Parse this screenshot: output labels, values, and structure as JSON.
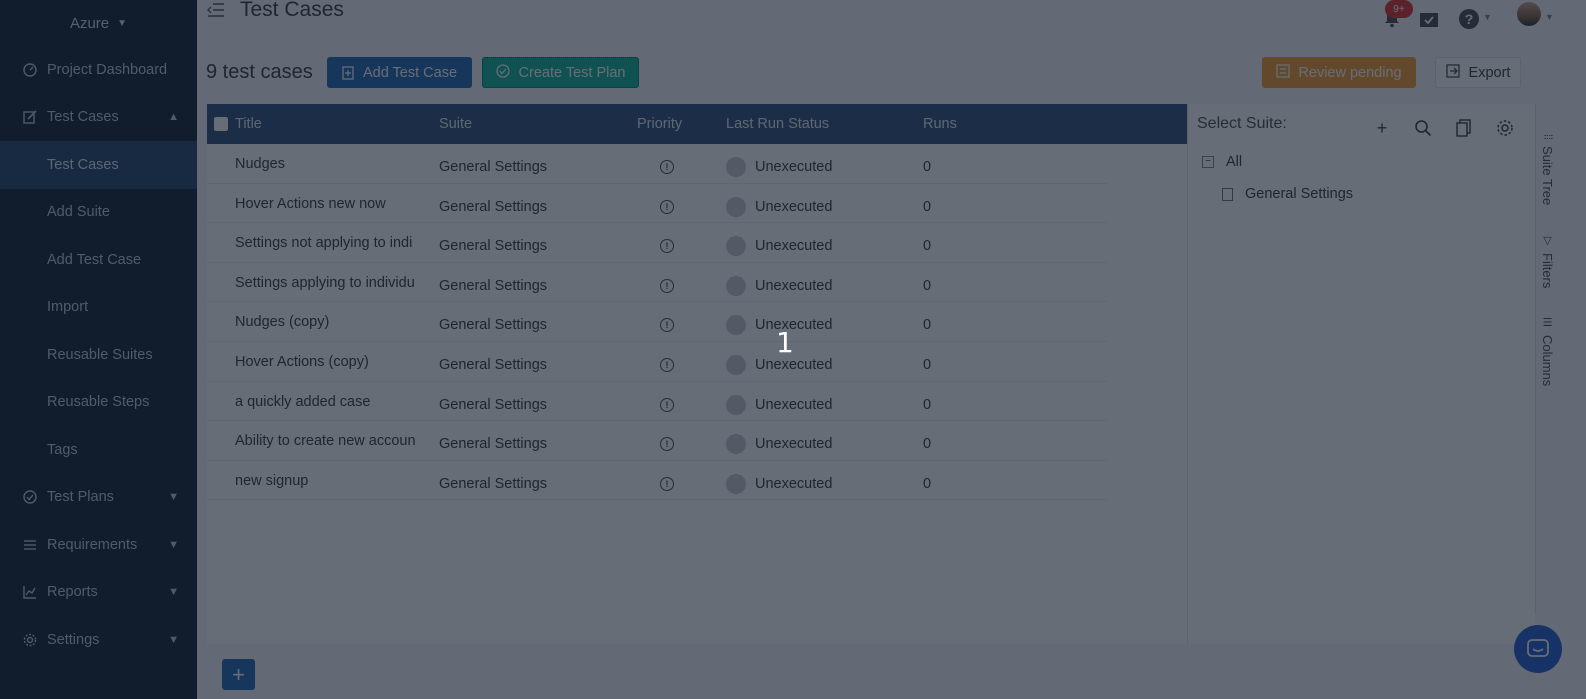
{
  "sidebar": {
    "workspace": "Azure",
    "items": [
      {
        "label": "Project Dashboard"
      },
      {
        "label": "Test Cases"
      },
      {
        "label": "Test Cases"
      },
      {
        "label": "Add Suite"
      },
      {
        "label": "Add Test Case"
      },
      {
        "label": "Import"
      },
      {
        "label": "Reusable Suites"
      },
      {
        "label": "Reusable Steps"
      },
      {
        "label": "Tags"
      },
      {
        "label": "Test Plans"
      },
      {
        "label": "Requirements"
      },
      {
        "label": "Reports"
      },
      {
        "label": "Settings"
      }
    ]
  },
  "header": {
    "title": "Test Cases",
    "notification_badge": "9+"
  },
  "toolbar": {
    "count": "9 test cases",
    "add_label": "Add Test Case",
    "plan_label": "Create Test Plan",
    "review_label": "Review pending",
    "export_label": "Export"
  },
  "table": {
    "columns": [
      "Title",
      "Suite",
      "Priority",
      "Last Run Status",
      "Runs"
    ],
    "rows": [
      {
        "title": "Nudges",
        "suite": "General Settings",
        "status": "Unexecuted",
        "runs": "0"
      },
      {
        "title": "Hover Actions new now",
        "suite": "General Settings",
        "status": "Unexecuted",
        "runs": "0"
      },
      {
        "title": "Settings not applying to indi",
        "suite": "General Settings",
        "status": "Unexecuted",
        "runs": "0"
      },
      {
        "title": "Settings applying to individu",
        "suite": "General Settings",
        "status": "Unexecuted",
        "runs": "0"
      },
      {
        "title": "Nudges (copy)",
        "suite": "General Settings",
        "status": "Unexecuted",
        "runs": "0"
      },
      {
        "title": "Hover Actions (copy)",
        "suite": "General Settings",
        "status": "Unexecuted",
        "runs": "0"
      },
      {
        "title": "a quickly added case",
        "suite": "General Settings",
        "status": "Unexecuted",
        "runs": "0"
      },
      {
        "title": "Ability to create new accoun",
        "suite": "General Settings",
        "status": "Unexecuted",
        "runs": "0"
      },
      {
        "title": "new signup",
        "suite": "General Settings",
        "status": "Unexecuted",
        "runs": "0"
      }
    ]
  },
  "suite_panel": {
    "heading": "Select Suite:",
    "tree": {
      "all": "All",
      "child": "General Settings"
    }
  },
  "side_tabs": {
    "suite_tree": "Suite Tree",
    "filters": "Filters",
    "columns": "Columns"
  },
  "overlay": {
    "counter": "1"
  },
  "colors": {
    "sidebar_bg": "#1e2b3b",
    "primary": "#2a6fb5",
    "teal": "#18b79b",
    "orange": "#f5a138",
    "table_header": "#3a5a80"
  }
}
